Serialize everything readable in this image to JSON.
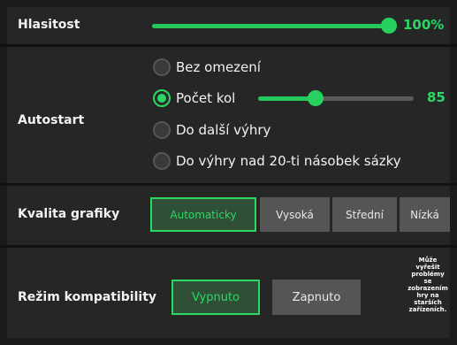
{
  "volume": {
    "label": "Hlasitost",
    "value_text": "100%",
    "level": 1.0
  },
  "autostart": {
    "label": "Autostart",
    "options": [
      {
        "label": "Bez omezení",
        "checked": false
      },
      {
        "label": "Počet kol",
        "checked": true
      },
      {
        "label": "Do další výhry",
        "checked": false
      },
      {
        "label": "Do výhry nad 20-ti násobek sázky",
        "checked": false
      }
    ],
    "rounds": {
      "value_text": "85",
      "level": 0.37
    }
  },
  "graphics": {
    "label": "Kvalita grafiky",
    "options": [
      "Automaticky",
      "Vysoká",
      "Střední",
      "Nízká"
    ],
    "selected": "Automaticky"
  },
  "compatibility": {
    "label": "Režim kompatibility",
    "off_label": "Vypnuto",
    "on_label": "Zapnuto",
    "selected": "Vypnuto",
    "note_lines": [
      "Může",
      "vyřešit",
      "problémy",
      "se",
      "zobrazením",
      "hry na",
      "starších",
      "zařízeních."
    ]
  },
  "colors": {
    "accent": "#2ad864",
    "panel": "#262626",
    "background": "#1a1a1a",
    "button": "#555555"
  }
}
